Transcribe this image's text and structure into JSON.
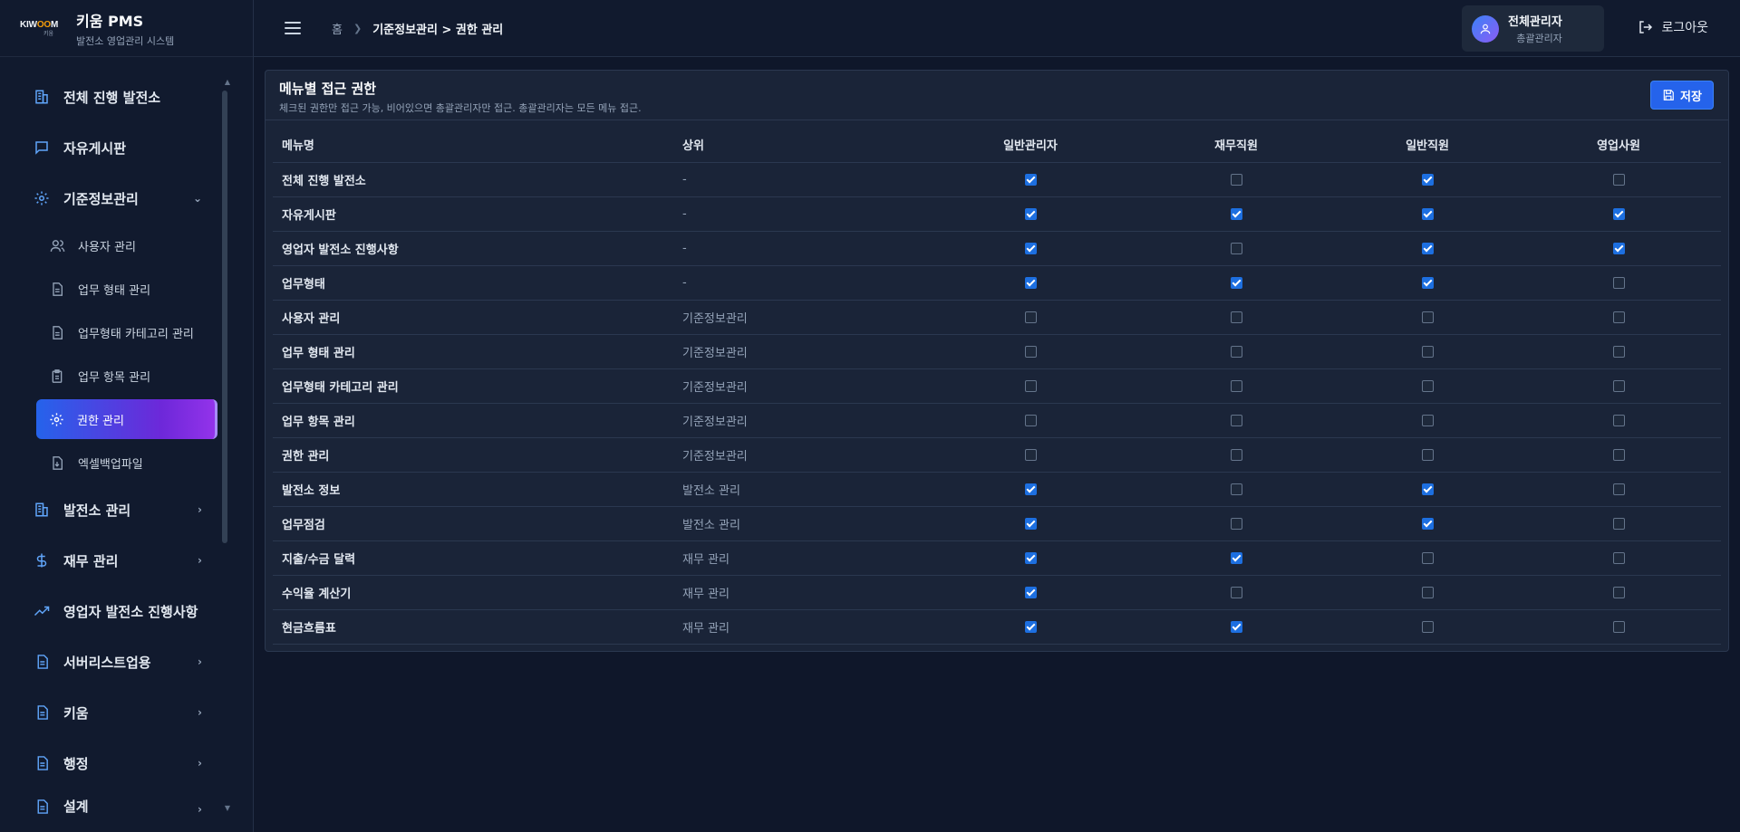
{
  "brand": {
    "logo_text": "KIWOOM",
    "logo_sub": "키움",
    "title": "키움 PMS",
    "subtitle": "발전소 영업관리 시스템"
  },
  "sidebar": {
    "items": [
      {
        "label": "전체 진행 발전소",
        "icon": "building-icon"
      },
      {
        "label": "자유게시판",
        "icon": "chat-icon"
      },
      {
        "label": "기준정보관리",
        "icon": "gear-icon",
        "expanded": true
      },
      {
        "label": "발전소 관리",
        "icon": "building-icon"
      },
      {
        "label": "재무 관리",
        "icon": "dollar-icon"
      },
      {
        "label": "영업자 발전소 진행사항",
        "icon": "trend-icon"
      },
      {
        "label": "서버리스트업용",
        "icon": "document-icon"
      },
      {
        "label": "키움",
        "icon": "document-icon"
      },
      {
        "label": "행정",
        "icon": "document-icon"
      },
      {
        "label": "설계",
        "icon": "document-icon"
      }
    ],
    "subitems": [
      {
        "label": "사용자 관리",
        "icon": "users-icon"
      },
      {
        "label": "업무 형태 관리",
        "icon": "document-icon"
      },
      {
        "label": "업무형태 카테고리 관리",
        "icon": "document-icon"
      },
      {
        "label": "업무 항목 관리",
        "icon": "clipboard-icon"
      },
      {
        "label": "권한 관리",
        "icon": "gear-icon",
        "active": true
      },
      {
        "label": "엑셀백업파일",
        "icon": "download-file-icon"
      }
    ]
  },
  "topbar": {
    "breadcrumb_home": "홈",
    "breadcrumb_current": "기준정보관리 > 권한 관리",
    "user_name": "전체관리자",
    "user_role": "총괄관리자",
    "logout_label": "로그아웃"
  },
  "card": {
    "title": "메뉴별 접근 권한",
    "description": "체크된 권한만 접근 가능, 비어있으면 총괄관리자만 접근. 총괄관리자는 모든 메뉴 접근.",
    "save_label": "저장"
  },
  "table": {
    "headers": [
      "메뉴명",
      "상위",
      "일반관리자",
      "재무직원",
      "일반직원",
      "영업사원"
    ],
    "rows": [
      {
        "menu": "전체 진행 발전소",
        "parent": "-",
        "perms": [
          true,
          false,
          true,
          false
        ]
      },
      {
        "menu": "자유게시판",
        "parent": "-",
        "perms": [
          true,
          true,
          true,
          true
        ]
      },
      {
        "menu": "영업자 발전소 진행사항",
        "parent": "-",
        "perms": [
          true,
          false,
          true,
          true
        ]
      },
      {
        "menu": "업무형태",
        "parent": "-",
        "perms": [
          true,
          true,
          true,
          false
        ]
      },
      {
        "menu": "사용자 관리",
        "parent": "기준정보관리",
        "perms": [
          false,
          false,
          false,
          false
        ]
      },
      {
        "menu": "업무 형태 관리",
        "parent": "기준정보관리",
        "perms": [
          false,
          false,
          false,
          false
        ]
      },
      {
        "menu": "업무형태 카테고리 관리",
        "parent": "기준정보관리",
        "perms": [
          false,
          false,
          false,
          false
        ]
      },
      {
        "menu": "업무 항목 관리",
        "parent": "기준정보관리",
        "perms": [
          false,
          false,
          false,
          false
        ]
      },
      {
        "menu": "권한 관리",
        "parent": "기준정보관리",
        "perms": [
          false,
          false,
          false,
          false
        ]
      },
      {
        "menu": "발전소 정보",
        "parent": "발전소 관리",
        "perms": [
          true,
          false,
          true,
          false
        ]
      },
      {
        "menu": "업무점검",
        "parent": "발전소 관리",
        "perms": [
          true,
          false,
          true,
          false
        ]
      },
      {
        "menu": "지출/수금 달력",
        "parent": "재무 관리",
        "perms": [
          true,
          true,
          false,
          false
        ]
      },
      {
        "menu": "수익율 계산기",
        "parent": "재무 관리",
        "perms": [
          true,
          false,
          false,
          false
        ]
      },
      {
        "menu": "현금흐름표",
        "parent": "재무 관리",
        "perms": [
          true,
          true,
          false,
          false
        ]
      }
    ]
  }
}
